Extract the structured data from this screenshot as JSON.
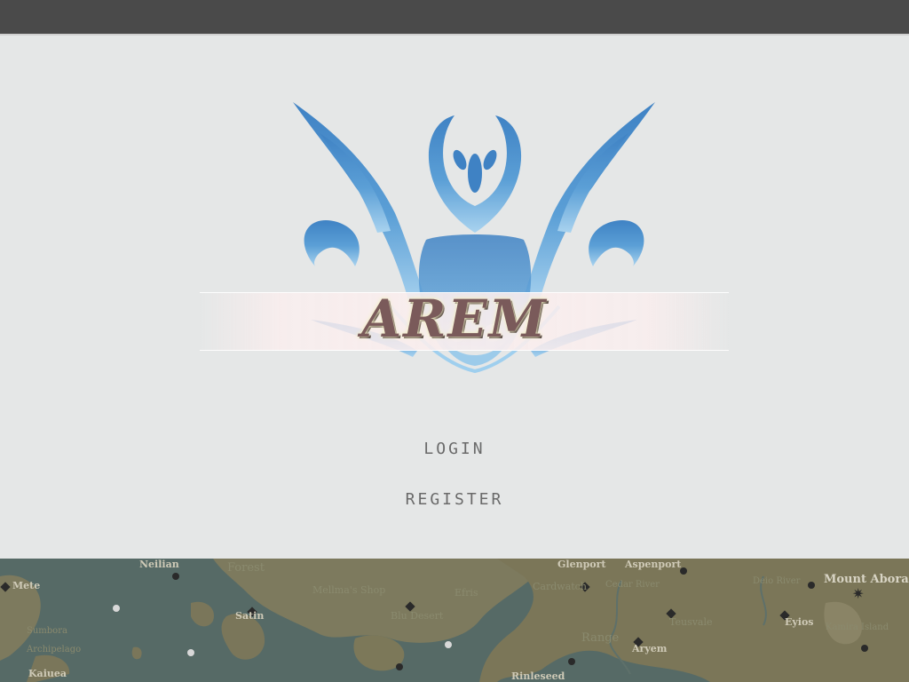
{
  "app": {
    "title": "AREM",
    "accent_color": "#4a8ac8",
    "title_color": "#7a5a5a"
  },
  "menu": {
    "login_label": "LOGIN",
    "register_label": "REGISTER"
  },
  "map": {
    "labels": {
      "neilian": "Neilian",
      "forest": "Forest",
      "mete": "Mete",
      "mellmas_shop": "Mellma's Shop",
      "satin": "Satin",
      "archipelago_a": "Sumbora",
      "archipelago_b": "Archipelago",
      "kaiuea": "Kaiuea",
      "blue_desert": "Blu Desert",
      "efris": "Efris",
      "glenport": "Glenport",
      "aspenport": "Aspenport",
      "cardwatch": "Cardwatch",
      "cedar_river": "Cedar River",
      "deio_river": "Deio River",
      "mount_abora": "Mount Abora",
      "eyios": "Eyios",
      "teusvale": "Teusvale",
      "range": "Range",
      "aryem": "Aryem",
      "rinleseed": "Rinleseed",
      "kamira": "Kamira Island"
    },
    "icons": [
      "star-marker-icon",
      "city-marker-icon",
      "mountain-marker-icon"
    ]
  }
}
